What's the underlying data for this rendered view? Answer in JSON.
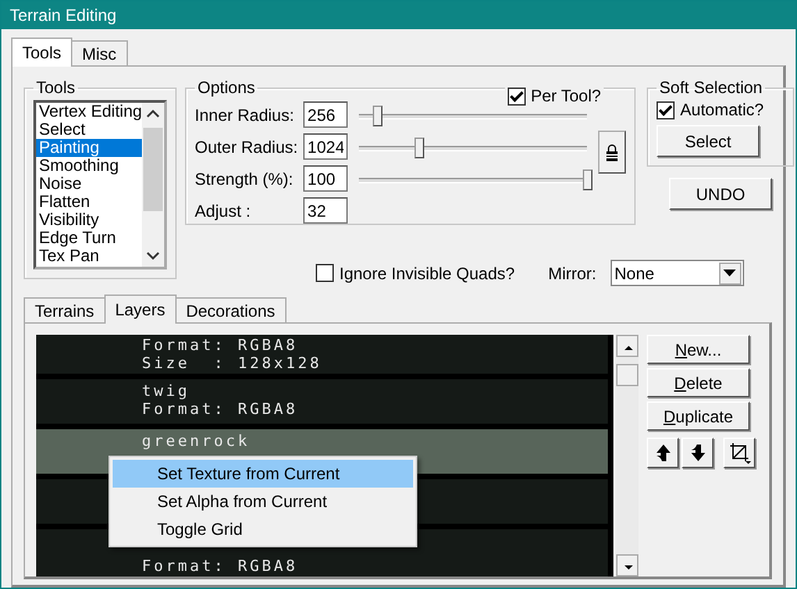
{
  "window": {
    "title": "Terrain Editing"
  },
  "tabs": [
    {
      "label": "Tools",
      "selected": true
    },
    {
      "label": "Misc",
      "selected": false
    }
  ],
  "tools": {
    "title": "Tools",
    "items": [
      {
        "label": "Vertex Editing",
        "selected": false
      },
      {
        "label": "Select",
        "selected": false
      },
      {
        "label": "Painting",
        "selected": true
      },
      {
        "label": "Smoothing",
        "selected": false
      },
      {
        "label": "Noise",
        "selected": false
      },
      {
        "label": "Flatten",
        "selected": false
      },
      {
        "label": "Visibility",
        "selected": false
      },
      {
        "label": "Edge Turn",
        "selected": false
      },
      {
        "label": "Tex Pan",
        "selected": false
      }
    ]
  },
  "options": {
    "title": "Options",
    "per_tool": {
      "label": "Per Tool?",
      "checked": true
    },
    "fields": [
      {
        "label": "Inner Radius:",
        "value": "256",
        "level": 0.08
      },
      {
        "label": "Outer Radius:",
        "value": "1024",
        "level": 0.26
      },
      {
        "label": "Strength (%):",
        "value": "100",
        "level": 1.0
      },
      {
        "label": "Adjust :",
        "value": "32"
      }
    ]
  },
  "soft_selection": {
    "title": "Soft Selection",
    "automatic": {
      "label": "Automatic?",
      "checked": true
    },
    "button": "Select"
  },
  "undo_button": "UNDO",
  "ignore_invisible": {
    "label": "Ignore Invisible Quads?",
    "checked": false
  },
  "mirror": {
    "label": "Mirror:",
    "value": "None"
  },
  "sub_tabs": [
    {
      "label": "Terrains",
      "selected": false
    },
    {
      "label": "Layers",
      "selected": true
    },
    {
      "label": "Decorations",
      "selected": false
    }
  ],
  "layers": [
    {
      "lines": [
        "Format: RGBA8",
        "Size  : 128x128"
      ],
      "selected": false
    },
    {
      "lines": [
        "twig",
        "Format: RGBA8"
      ],
      "selected": false
    },
    {
      "lines": [
        "greenrock"
      ],
      "selected": true
    },
    {
      "selected": false
    },
    {
      "lines": [
        "Format: RGBA8"
      ],
      "selected": false
    }
  ],
  "layer_buttons": [
    "New...",
    "Delete",
    "Duplicate"
  ],
  "context_menu": [
    {
      "label": "Set Texture from Current",
      "selected": true
    },
    {
      "label": "Set Alpha from Current",
      "selected": false
    },
    {
      "label": "Toggle Grid",
      "selected": false
    }
  ]
}
